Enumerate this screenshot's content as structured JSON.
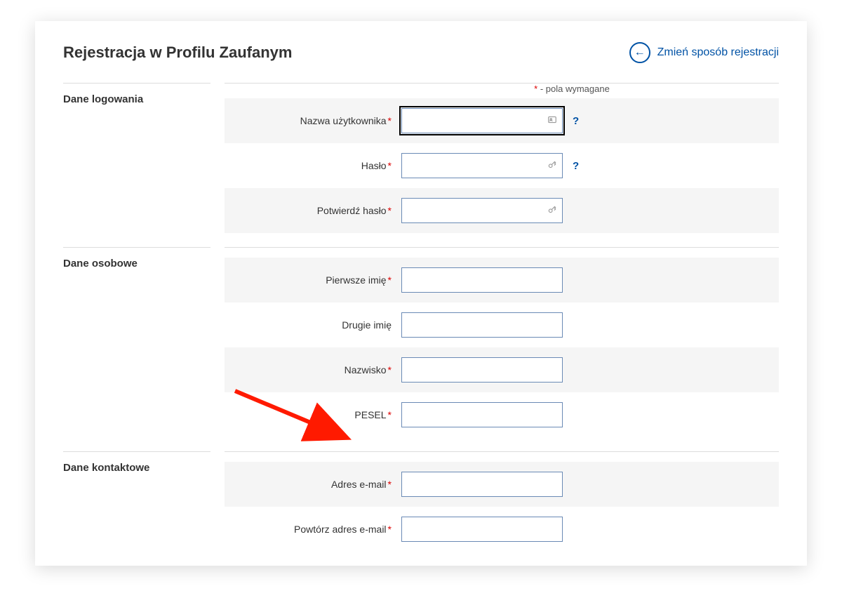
{
  "header": {
    "title": "Rejestracja w Profilu Zaufanym",
    "change_link": "Zmień sposób rejestracji"
  },
  "required_note": {
    "star": "*",
    "text": " - pola wymagane"
  },
  "sections": {
    "login": {
      "title": "Dane logowania",
      "fields": {
        "username_label": "Nazwa użytkownika",
        "password_label": "Hasło",
        "confirm_password_label": "Potwierdź hasło"
      }
    },
    "personal": {
      "title": "Dane osobowe",
      "fields": {
        "first_name_label": "Pierwsze imię",
        "middle_name_label": "Drugie imię",
        "last_name_label": "Nazwisko",
        "pesel_label": "PESEL"
      }
    },
    "contact": {
      "title": "Dane kontaktowe",
      "fields": {
        "email_label": "Adres e-mail",
        "email_repeat_label": "Powtórz adres e-mail"
      }
    }
  },
  "help_symbol": "?",
  "required_marker": "*"
}
